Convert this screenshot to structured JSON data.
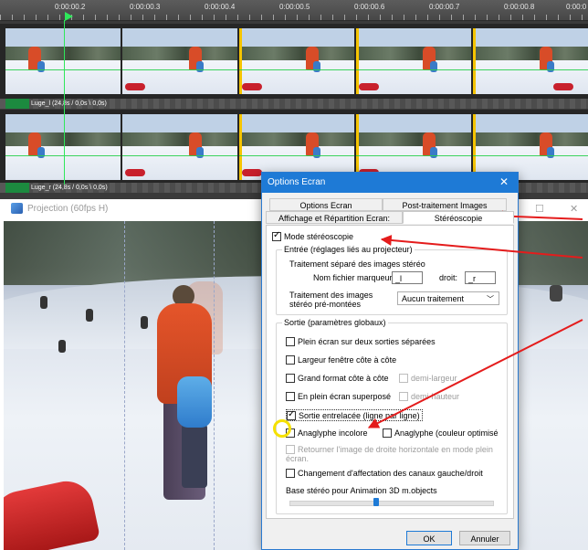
{
  "timeline": {
    "timecodes": [
      "0:00:00.2",
      "0:00:00.3",
      "0:00:00.4",
      "0:00:00.5",
      "0:00:00.6",
      "0:00:00.7",
      "0:00:00.8",
      "0:00:0"
    ],
    "track1_label": "Luge_l (24,8s / 0,0s \\ 0,0s)",
    "track2_label": "Luge_r (24,8s / 0,0s \\ 0,0s)"
  },
  "projection": {
    "title": "Projection (60fps H)",
    "minimize": "—",
    "maximize": "☐",
    "close": "✕"
  },
  "dialog": {
    "title": "Options Ecran",
    "close": "✕",
    "tabs": [
      "Options Ecran",
      "Post-traitement Images",
      "Affichage et Répartition Ecran:",
      "Stéréoscopie"
    ],
    "stereo_mode": "Mode stéréoscopie",
    "input_group": {
      "caption": "Entrée (réglages liés au projecteur)",
      "separate_label": "Traitement séparé des images stéréo",
      "marker_name_label": "Nom fichier marqueur",
      "marker_left": "_l",
      "right_label": "droit:",
      "marker_right": "_r",
      "premounted_label": "Traitement des images stéréo pré-montées",
      "premounted_value": "Aucun traitement"
    },
    "output_group": {
      "caption": "Sortie (paramètres globaux)",
      "fullscreen_two": "Plein écran sur deux sorties séparées",
      "side_by_side": "Largeur fenêtre côte à côte",
      "large_side": "Grand format côte à côte",
      "half_width": "demi-largeur",
      "fullscreen_over": "En plein écran superposé",
      "half_height": "demi-hauteur",
      "interlaced": "Sortie entrelacée (ligne par ligne)",
      "anaglyph_gray": "Anaglyphe incolore",
      "anaglyph_color": "Anaglyphe (couleur optimisé",
      "flip_right": "Retourner l'image de droite horizontale en mode plein écran.",
      "swap_channels": "Changement d'affectation des canaux gauche/droit",
      "base_label": "Base stéréo pour Animation 3D m.objects"
    },
    "slider_value": 0.43,
    "ok": "OK",
    "cancel": "Annuler"
  },
  "colors": {
    "accent": "#1e7ad6",
    "annotation_red": "#e41c1c",
    "highlight_yellow": "#f5e100",
    "playhead": "#2ee85a"
  }
}
